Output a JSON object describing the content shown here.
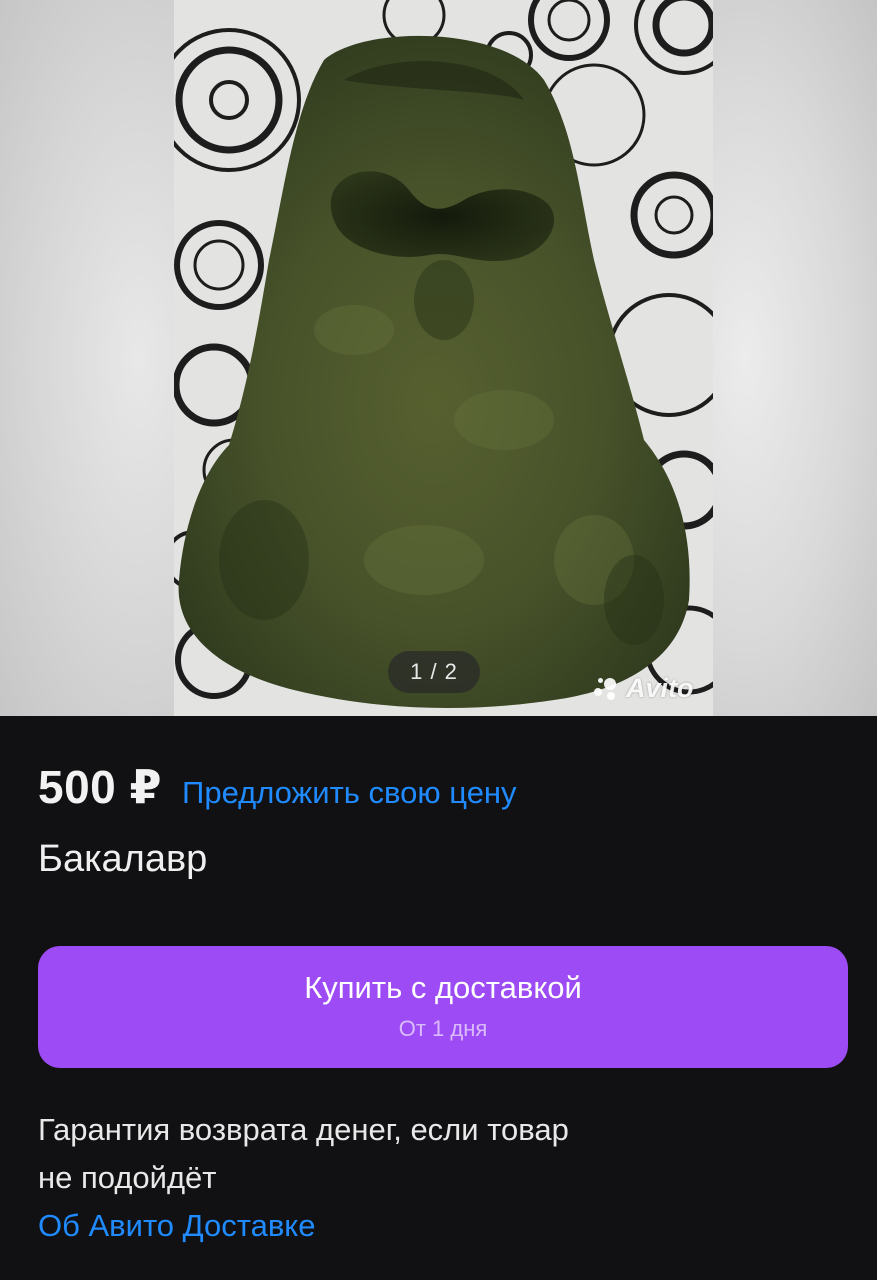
{
  "gallery": {
    "counter": "1 / 2",
    "watermark": "Avito"
  },
  "listing": {
    "price": "500 ₽",
    "offer_link": "Предложить свою цену",
    "title": "Бакалавр"
  },
  "buy_button": {
    "label": "Купить с доставкой",
    "sublabel": "От 1 дня"
  },
  "guarantee": {
    "line1": "Гарантия возврата денег, если товар",
    "line2": "не подойдёт"
  },
  "delivery_link": "Об Авито Доставке",
  "colors": {
    "background": "#111113",
    "accent_link": "#1f8bff",
    "buy_button": "#9d4cf5",
    "text": "#efefef"
  }
}
